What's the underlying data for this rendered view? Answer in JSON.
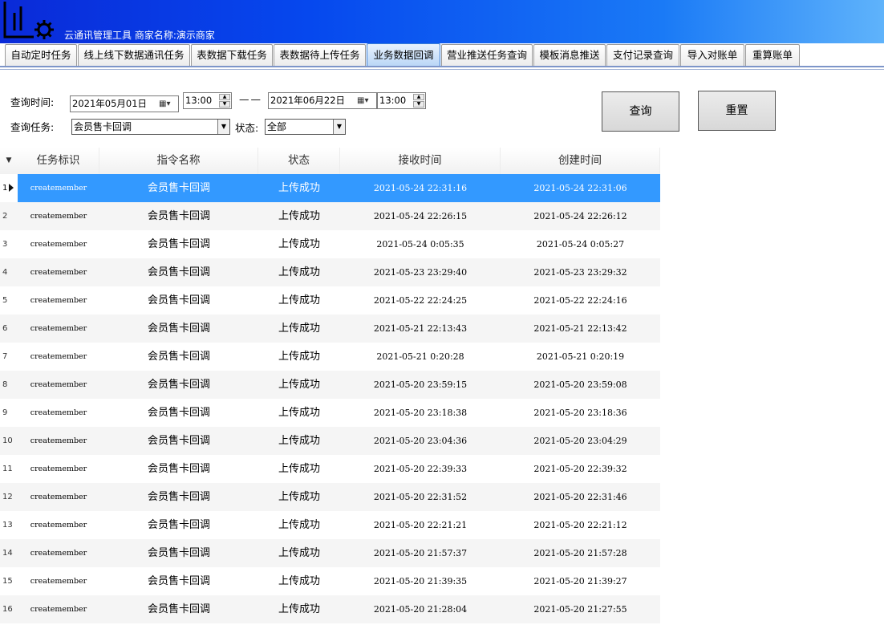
{
  "app": {
    "title": "云通讯管理工具 商家名称:演示商家"
  },
  "tabs": [
    {
      "label": "自动定时任务"
    },
    {
      "label": "线上线下数据通讯任务"
    },
    {
      "label": "表数据下载任务"
    },
    {
      "label": "表数据待上传任务"
    },
    {
      "label": "业务数据回调",
      "active": true
    },
    {
      "label": "营业推送任务查询"
    },
    {
      "label": "模板消息推送"
    },
    {
      "label": "支付记录查询"
    },
    {
      "label": "导入对账单"
    },
    {
      "label": "重算账单"
    }
  ],
  "query": {
    "time_label": "查询时间:",
    "start_date": "2021年05月01日",
    "start_time": "13:00",
    "separator": "——",
    "end_date": "2021年06月22日",
    "end_time": "13:00",
    "task_label": "查询任务:",
    "task_value": "会员售卡回调",
    "status_label": "状态:",
    "status_value": "全部",
    "search_button": "查询",
    "reset_button": "重置"
  },
  "grid": {
    "columns": [
      "任务标识",
      "指令名称",
      "状态",
      "接收时间",
      "创建时间"
    ],
    "rows": [
      {
        "n": "1",
        "id": "createmember",
        "name": "会员售卡回调",
        "status": "上传成功",
        "recv": "2021-05-24 22:31:16",
        "created": "2021-05-24 22:31:06"
      },
      {
        "n": "2",
        "id": "createmember",
        "name": "会员售卡回调",
        "status": "上传成功",
        "recv": "2021-05-24 22:26:15",
        "created": "2021-05-24 22:26:12"
      },
      {
        "n": "3",
        "id": "createmember",
        "name": "会员售卡回调",
        "status": "上传成功",
        "recv": "2021-05-24 0:05:35",
        "created": "2021-05-24 0:05:27"
      },
      {
        "n": "4",
        "id": "createmember",
        "name": "会员售卡回调",
        "status": "上传成功",
        "recv": "2021-05-23 23:29:40",
        "created": "2021-05-23 23:29:32"
      },
      {
        "n": "5",
        "id": "createmember",
        "name": "会员售卡回调",
        "status": "上传成功",
        "recv": "2021-05-22 22:24:25",
        "created": "2021-05-22 22:24:16"
      },
      {
        "n": "6",
        "id": "createmember",
        "name": "会员售卡回调",
        "status": "上传成功",
        "recv": "2021-05-21 22:13:43",
        "created": "2021-05-21 22:13:42"
      },
      {
        "n": "7",
        "id": "createmember",
        "name": "会员售卡回调",
        "status": "上传成功",
        "recv": "2021-05-21 0:20:28",
        "created": "2021-05-21 0:20:19"
      },
      {
        "n": "8",
        "id": "createmember",
        "name": "会员售卡回调",
        "status": "上传成功",
        "recv": "2021-05-20 23:59:15",
        "created": "2021-05-20 23:59:08"
      },
      {
        "n": "9",
        "id": "createmember",
        "name": "会员售卡回调",
        "status": "上传成功",
        "recv": "2021-05-20 23:18:38",
        "created": "2021-05-20 23:18:36"
      },
      {
        "n": "10",
        "id": "createmember",
        "name": "会员售卡回调",
        "status": "上传成功",
        "recv": "2021-05-20 23:04:36",
        "created": "2021-05-20 23:04:29"
      },
      {
        "n": "11",
        "id": "createmember",
        "name": "会员售卡回调",
        "status": "上传成功",
        "recv": "2021-05-20 22:39:33",
        "created": "2021-05-20 22:39:32"
      },
      {
        "n": "12",
        "id": "createmember",
        "name": "会员售卡回调",
        "status": "上传成功",
        "recv": "2021-05-20 22:31:52",
        "created": "2021-05-20 22:31:46"
      },
      {
        "n": "13",
        "id": "createmember",
        "name": "会员售卡回调",
        "status": "上传成功",
        "recv": "2021-05-20 22:21:21",
        "created": "2021-05-20 22:21:12"
      },
      {
        "n": "14",
        "id": "createmember",
        "name": "会员售卡回调",
        "status": "上传成功",
        "recv": "2021-05-20 21:57:37",
        "created": "2021-05-20 21:57:28"
      },
      {
        "n": "15",
        "id": "createmember",
        "name": "会员售卡回调",
        "status": "上传成功",
        "recv": "2021-05-20 21:39:35",
        "created": "2021-05-20 21:39:27"
      },
      {
        "n": "16",
        "id": "createmember",
        "name": "会员售卡回调",
        "status": "上传成功",
        "recv": "2021-05-20 21:28:04",
        "created": "2021-05-20 21:27:55"
      }
    ]
  },
  "colors": {
    "title_start": "#0a2ad8",
    "title_end": "#5fb3fb",
    "selected_row": "#3399ff",
    "stripe": "#f5f5f5"
  }
}
